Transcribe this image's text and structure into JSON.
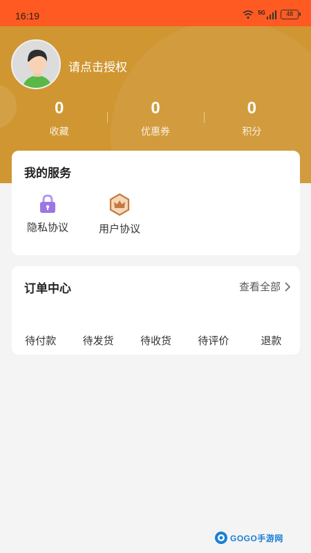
{
  "status_bar": {
    "time": "16:19",
    "network": "5G",
    "battery": "48"
  },
  "profile": {
    "auth_prompt": "请点击授权"
  },
  "stats": [
    {
      "value": "0",
      "label": "收藏"
    },
    {
      "value": "0",
      "label": "优惠券"
    },
    {
      "value": "0",
      "label": "积分"
    }
  ],
  "services": {
    "title": "我的服务",
    "items": [
      {
        "label": "隐私协议",
        "icon": "lock-icon"
      },
      {
        "label": "用户协议",
        "icon": "crown-icon"
      }
    ]
  },
  "orders": {
    "title": "订单中心",
    "view_all": "查看全部",
    "tabs": [
      "待付款",
      "待发货",
      "待收货",
      "待评价",
      "退款"
    ]
  },
  "watermark": {
    "text": "GOGO手游网"
  },
  "colors": {
    "status_bar": "#fe5a22",
    "header": "#d09632",
    "accent": "#a07de0"
  }
}
